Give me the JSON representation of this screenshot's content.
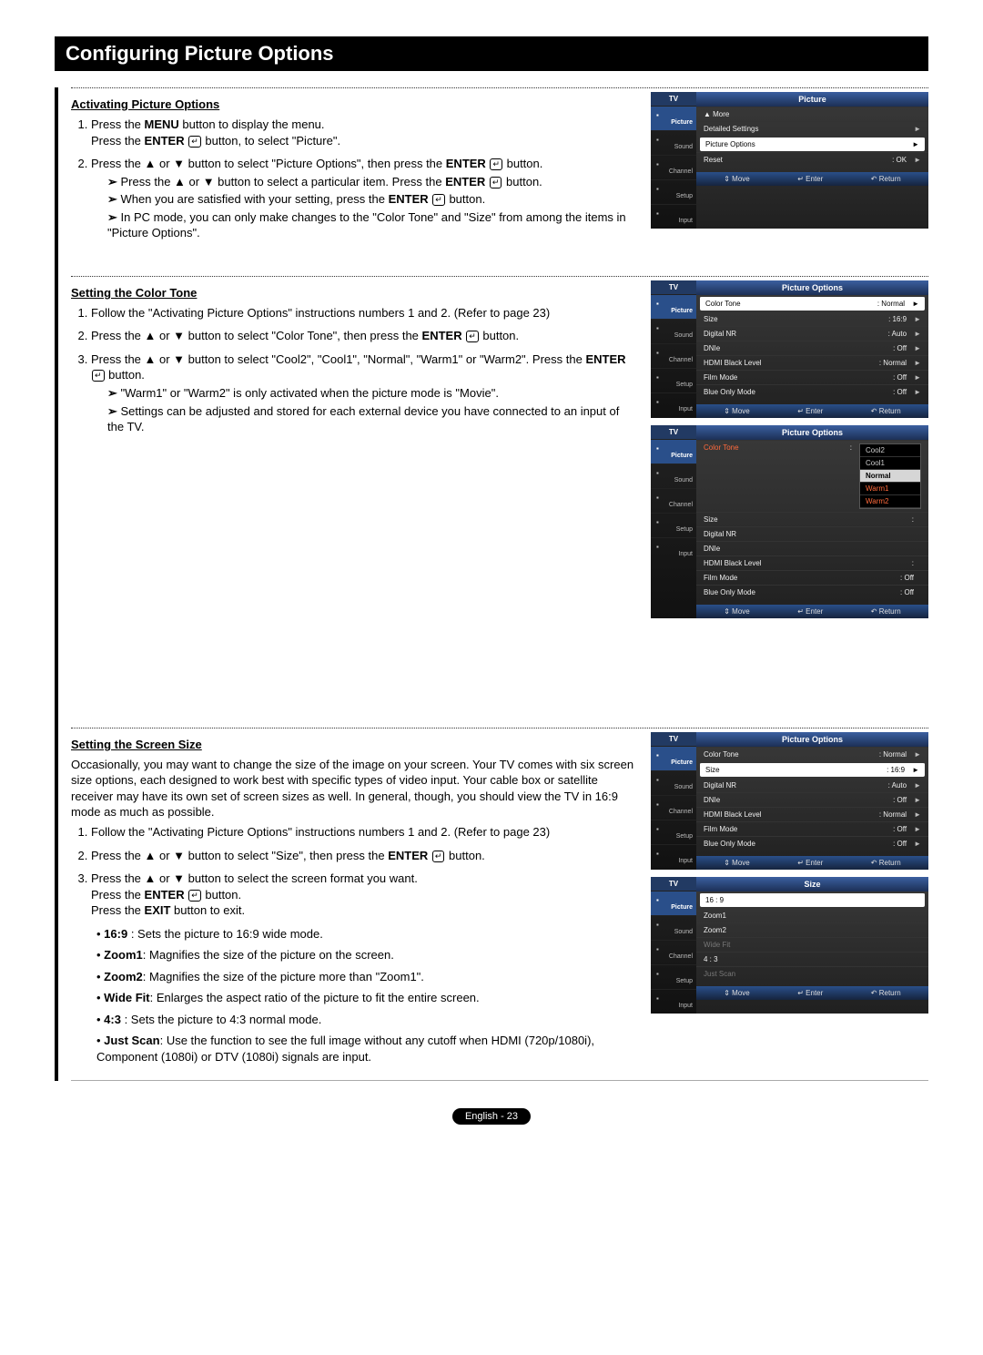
{
  "title": "Configuring Picture Options",
  "sections": {
    "activating": {
      "heading": "Activating Picture Options",
      "step1a": "Press the ",
      "step1b": " button to display the menu.",
      "step1c": "Press the ",
      "step1d": " button, to select \"Picture\".",
      "step2a": "Press the ▲ or ▼ button to select \"Picture Options\", then press the ",
      "step2b": " button.",
      "note1a": "Press the ▲ or ▼ button to select a particular item. Press the ",
      "note1b": " button.",
      "note2a": "When you are satisfied with your setting, press the ",
      "note2b": " button.",
      "note3": "In PC mode, you can only make changes to the \"Color Tone\" and \"Size\" from among the items in \"Picture Options\"."
    },
    "colortone": {
      "heading": "Setting the Color Tone",
      "step1": "Follow the \"Activating Picture Options\" instructions numbers 1 and 2. (Refer to page 23)",
      "step2a": "Press the ▲ or ▼ button to select \"Color Tone\", then press the ",
      "step2b": " button.",
      "step3a": "Press the ▲ or ▼ button to select \"Cool2\", \"Cool1\", \"Normal\", \"Warm1\" or \"Warm2\". Press the ",
      "step3b": " button.",
      "note1": "\"Warm1\" or \"Warm2\" is only activated when the picture mode is \"Movie\".",
      "note2": "Settings can be adjusted and stored for each external device you have connected to an input of the TV."
    },
    "screensize": {
      "heading": "Setting the Screen Size",
      "intro": "Occasionally, you may want to change the size of the image on your screen. Your TV comes with six screen size options, each designed to work best with specific types of video input. Your cable box or satellite receiver may have its own set of screen sizes as well. In general, though, you should view the TV in 16:9 mode as much as possible.",
      "step1": "Follow the \"Activating Picture Options\" instructions numbers 1 and 2. (Refer to page 23)",
      "step2a": "Press the ▲ or ▼ button to select \"Size\", then press the ",
      "step2b": " button.",
      "step3a": "Press the ▲ or ▼ button to select the screen format you want.",
      "step3b": "Press the ",
      "step3c": " button.",
      "step4a": "Press the ",
      "step4b": " button to exit.",
      "b1": " : Sets the picture to 16:9 wide mode.",
      "b2": ": Magnifies the size of the picture on the screen.",
      "b3": ": Magnifies the size of the picture more than \"Zoom1\".",
      "b4": ": Enlarges the aspect ratio of the picture to fit the entire screen.",
      "b5": " : Sets the picture to 4:3 normal mode.",
      "b6": ": Use the function to see the full image without any cutoff when HDMI (720p/1080i), Component (1080i) or DTV (1080i) signals are input."
    }
  },
  "kw": {
    "menu": "MENU",
    "enter": "ENTER",
    "exit": "EXIT",
    "b169": "16:9",
    "bzoom1": "Zoom1",
    "bzoom2": "Zoom2",
    "bwide": "Wide Fit",
    "b43": "4:3",
    "bjust": "Just Scan"
  },
  "osd": {
    "tv": "TV",
    "side": [
      "Picture",
      "Sound",
      "Channel",
      "Setup",
      "Input"
    ],
    "foot_move": "Move",
    "foot_enter": "Enter",
    "foot_return": "Return",
    "menu1": {
      "title": "Picture",
      "rows": [
        {
          "lab": "▲ More",
          "val": "",
          "arr": ""
        },
        {
          "lab": "Detailed Settings",
          "val": "",
          "arr": "►"
        },
        {
          "lab": "Picture Options",
          "val": "",
          "arr": "►",
          "hl": true
        },
        {
          "lab": "Reset",
          "val": ": OK",
          "arr": "►"
        }
      ]
    },
    "menu2": {
      "title": "Picture Options",
      "rows": [
        {
          "lab": "Color Tone",
          "val": ": Normal",
          "arr": "►",
          "hl": true
        },
        {
          "lab": "Size",
          "val": ": 16:9",
          "arr": "►"
        },
        {
          "lab": "Digital NR",
          "val": ": Auto",
          "arr": "►"
        },
        {
          "lab": "DNIe",
          "val": ": Off",
          "arr": "►"
        },
        {
          "lab": "HDMI Black Level",
          "val": ": Normal",
          "arr": "►"
        },
        {
          "lab": "Film Mode",
          "val": ": Off",
          "arr": "►"
        },
        {
          "lab": "Blue Only Mode",
          "val": ": Off",
          "arr": "►"
        }
      ]
    },
    "menu3": {
      "title": "Picture Options",
      "rows": [
        {
          "lab": "Color Tone",
          "val": ":",
          "dd": true
        },
        {
          "lab": "Size",
          "val": ":"
        },
        {
          "lab": "Digital NR",
          "val": ""
        },
        {
          "lab": "DNIe",
          "val": ""
        },
        {
          "lab": "HDMI Black Level",
          "val": ":"
        },
        {
          "lab": "Film Mode",
          "val": ": Off"
        },
        {
          "lab": "Blue Only Mode",
          "val": ": Off"
        }
      ],
      "dd": [
        "Cool2",
        "Cool1",
        "Normal",
        "Warm1",
        "Warm2"
      ],
      "ddsel": "Normal"
    },
    "menu4": {
      "title": "Picture Options",
      "rows": [
        {
          "lab": "Color Tone",
          "val": ": Normal",
          "arr": "►"
        },
        {
          "lab": "Size",
          "val": ": 16:9",
          "arr": "►",
          "hl": true
        },
        {
          "lab": "Digital NR",
          "val": ": Auto",
          "arr": "►"
        },
        {
          "lab": "DNIe",
          "val": ": Off",
          "arr": "►"
        },
        {
          "lab": "HDMI Black Level",
          "val": ": Normal",
          "arr": "►"
        },
        {
          "lab": "Film Mode",
          "val": ": Off",
          "arr": "►"
        },
        {
          "lab": "Blue Only Mode",
          "val": ": Off",
          "arr": "►"
        }
      ]
    },
    "menu5": {
      "title": "Size",
      "rows": [
        {
          "lab": "16 : 9",
          "hl": true
        },
        {
          "lab": "Zoom1"
        },
        {
          "lab": "Zoom2"
        },
        {
          "lab": "Wide Fit",
          "dim": true
        },
        {
          "lab": "4 : 3"
        },
        {
          "lab": "Just Scan",
          "dim": true
        }
      ]
    }
  },
  "footer": "English - 23"
}
